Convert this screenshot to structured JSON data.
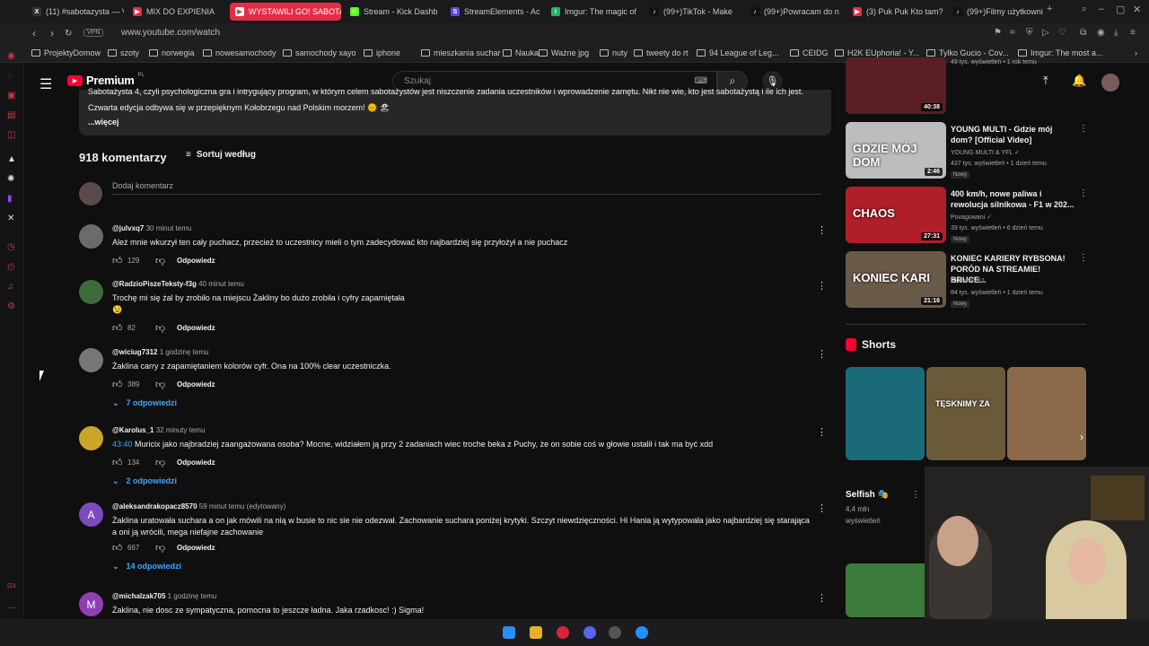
{
  "browser": {
    "tabs": [
      {
        "label": "(11) #sabotazysta — V",
        "color": "#333333",
        "glyph": "X"
      },
      {
        "label": "MIX DO EXPIENIA",
        "color": "#e42d45",
        "glyph": "▶"
      },
      {
        "label": "WYSTAWILI GO! SABOTA",
        "color": "#ffffff",
        "glyph": "▶"
      },
      {
        "label": "Stream - Kick Dashb",
        "color": "#53fc18",
        "glyph": "K"
      },
      {
        "label": "StreamElements - Ac",
        "color": "#5b4ae0",
        "glyph": "S"
      },
      {
        "label": "Imgur: The magic of",
        "color": "#1bb76e",
        "glyph": "i"
      },
      {
        "label": "(99+)TikTok - Make",
        "color": "#111111",
        "glyph": "♪"
      },
      {
        "label": "(99+)Powracam do n",
        "color": "#111111",
        "glyph": "♪"
      },
      {
        "label": "(3) Puk Puk Kto tam?",
        "color": "#e42d45",
        "glyph": "▶"
      },
      {
        "label": "(99+)Filmy użytkowni",
        "color": "#111111",
        "glyph": "♪"
      }
    ],
    "url": "www.youtube.com/watch",
    "vpn": "VPN",
    "bookmarks": [
      "ProjektyDomow",
      "szoty",
      "norwegia",
      "nowesamochody",
      "samochody xayo",
      "iphone",
      "mieszkania suchar",
      "Nauka",
      "Ważne jpg",
      "nuty",
      "tweety do rt",
      "94 League of Leg...",
      "CEIDG",
      "H2K EUphoria! - Y...",
      "Tylko Gucio - Cov...",
      "Imgur: The most a..."
    ]
  },
  "youtube": {
    "logo_text": "Premium",
    "logo_country": "PL",
    "search_placeholder": "Szukaj",
    "description": {
      "line1": "Sabotażysta 4, czyli psychologiczna gra i intrygujący program, w którym celem sabotażystów jest niszczenie zadania uczestników i wprowadzenie zamętu. Nikt nie wie, kto jest sabotażystą i ile ich jest.",
      "line2": "Czwarta edycja odbywa się w przepięknym Kołobrzegu nad Polskim morzem! 🌞 🏖",
      "more": "...więcej"
    },
    "comments_count": "918 komentarzy",
    "sort_label": "Sortuj według",
    "add_comment_placeholder": "Dodaj komentarz",
    "reply_label": "Odpowiedz",
    "comments": [
      {
        "author": "@julvxq7",
        "time": "30 minut temu",
        "text": "Ależ mnie wkurzył ten cały puchacz, przecież to uczestnicy mieli o tym zadecydować kto najbardziej się przyłożył a nie  puchacz",
        "likes": "129",
        "replies": "",
        "avatar_color": "#6b6b6b",
        "avatar_letter": ""
      },
      {
        "author": "@RadzioPiszeTeksty-f3g",
        "time": "40 minut temu",
        "text": "Trochę mi się żal by zrobiło na miejscu Żakliny bo dużo zrobiła i cyfry zapamiętała",
        "text2": "😉",
        "likes": "82",
        "replies": "",
        "avatar_color": "#3f6b3a",
        "avatar_letter": ""
      },
      {
        "author": "@wiciug7312",
        "time": "1 godzinę temu",
        "text": "Żaklina carry z zapamiętaniem kolorów cyfr. Ona na 100% clear uczestniczka.",
        "likes": "389",
        "replies": "7 odpowiedzi",
        "avatar_color": "#777777",
        "avatar_letter": ""
      },
      {
        "author": "@Karolus_1",
        "time": "32 minuty temu",
        "ts": "43:40",
        "text": " Muricix jako najbradziej zaangażowana osoba? Mocne, widziałem ją przy 2 zadaniach wiec troche beka z Puchy, że on sobie coś w głowie ustalił i tak ma być xdd",
        "likes": "134",
        "replies": "2 odpowiedzi",
        "avatar_color": "#c9a52a",
        "avatar_letter": ""
      },
      {
        "author": "@aleksandrakopacz8570",
        "time": "59 minut temu (edytowany)",
        "text": "Żaklina uratowała suchara a on jak mówili na nią w busie to nic sie nie odezwał. Zachowanie suchara poniżej krytyki. Szczyt niewdzięczności. Hi Hania ją wytypowała jako najbardziej się starająca a oni ją wrócili, mega niefajne zachowanie",
        "likes": "667",
        "replies": "14 odpowiedzi",
        "avatar_color": "#7b4bbf",
        "avatar_letter": "A"
      },
      {
        "author": "@michalzak705",
        "time": "1 godzinę temu",
        "text": "Żaklina, nie dosc ze sympatyczna, pomocna to jeszcze ładna. Jaka rzadkosc! :) Sigma!",
        "likes": "",
        "replies": "",
        "avatar_color": "#8e3fb3",
        "avatar_letter": "M"
      }
    ],
    "related": [
      {
        "title": "",
        "channel": "",
        "meta": "49 tys. wyświetleń • 1 rok temu",
        "duration": "40:38",
        "badge": "",
        "thumb": "#5a1f24"
      },
      {
        "title": "YOUNG MULTI - Gdzie mój dom? [Official Video]",
        "channel": "YOUNG MULTI & YFL ✓",
        "meta": "437 tys. wyświetleń • 1 dzień temu",
        "duration": "2:46",
        "badge": "Nowy",
        "thumb": "#bdbdbd",
        "thumb_text": "GDZIE MÓJ DOM"
      },
      {
        "title": "400 km/h, nowe paliwa i rewolucja silnikowa - F1 w 202...",
        "channel": "Povagowani ✓",
        "meta": "39 tys. wyświetleń • 6 dzień temu",
        "duration": "27:31",
        "badge": "Nowy",
        "thumb": "#b01e2a",
        "thumb_text": "CHAOS"
      },
      {
        "title": "KONIEC KARIERY RYBSONA! PORÓD NA STREAMIE! BRUCE...",
        "channel": "SzklanaY2J",
        "meta": "84 tys. wyświetleń • 1 dzień temu",
        "duration": "21:16",
        "badge": "Nowy",
        "thumb": "#6a5a4a",
        "thumb_text": "KONIEC KARI"
      }
    ],
    "shorts_label": "Shorts",
    "shorts": [
      {
        "title": "Selfish 🎭",
        "views": "4,4 mln",
        "views2": "wyświetleń",
        "color": "#1a6a7a"
      },
      {
        "title": "",
        "views": "",
        "thumb_text": "TĘSKNIMY ZA",
        "color": "#6b5a3a"
      },
      {
        "title": "",
        "views": "",
        "color": "#8a6a4a"
      }
    ]
  },
  "colors": {
    "accent": "#ff0033",
    "link": "#3ea6ff",
    "bg": "#0f0f0f"
  }
}
